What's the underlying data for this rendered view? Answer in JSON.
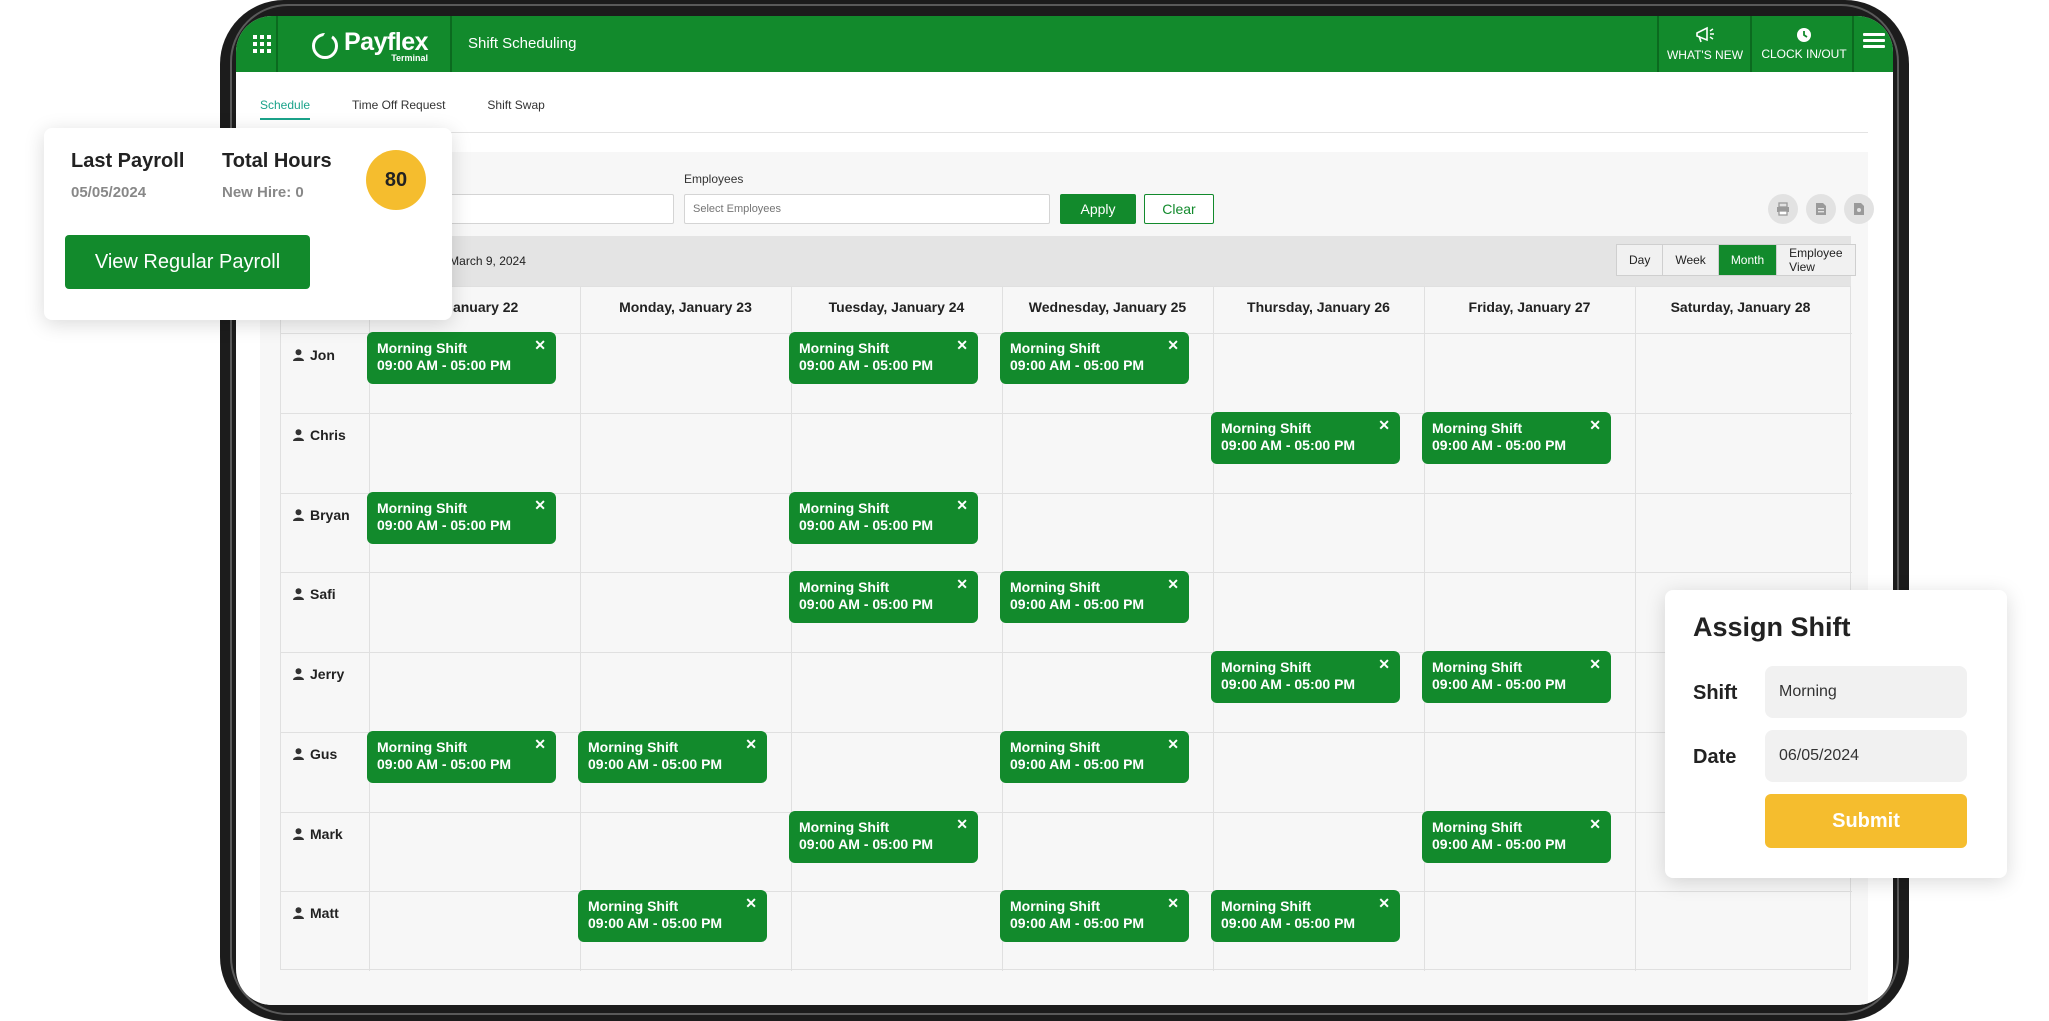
{
  "app": {
    "logo_text": "Payflex",
    "logo_sub": "Terminal",
    "title": "Shift Scheduling",
    "whats_new": "WHAT'S NEW",
    "clock": "CLOCK IN/OUT"
  },
  "tabs": [
    "Schedule",
    "Time Off Request",
    "Shift Swap"
  ],
  "filters": {
    "employees_label": "Employees",
    "employees_placeholder": "Select Employees",
    "apply": "Apply",
    "clear": "Clear"
  },
  "date_range": "3, 2024 – Saturday, March 9, 2024",
  "views": [
    "Day",
    "Week",
    "Month",
    "Employee View"
  ],
  "active_view": "Month",
  "days": [
    "y, January 22",
    "Monday, January 23",
    "Tuesday, January 24",
    "Wednesday, January 25",
    "Thursday, January 26",
    "Friday, January 27",
    "Saturday, January 28"
  ],
  "shift_name": "Morning Shift",
  "shift_time": "09:00 AM - 05:00 PM",
  "employees": [
    {
      "name": "Jon",
      "shifts": [
        0,
        2,
        3
      ]
    },
    {
      "name": "Chris",
      "shifts": [
        4,
        5
      ]
    },
    {
      "name": "Bryan",
      "shifts": [
        0,
        2
      ]
    },
    {
      "name": "Safi",
      "shifts": [
        2,
        3
      ]
    },
    {
      "name": "Jerry",
      "shifts": [
        4,
        5
      ]
    },
    {
      "name": "Gus",
      "shifts": [
        0,
        1,
        3
      ]
    },
    {
      "name": "Mark",
      "shifts": [
        2,
        5
      ]
    },
    {
      "name": "Matt",
      "shifts": [
        1,
        3,
        4
      ]
    }
  ],
  "payroll_card": {
    "last_payroll_label": "Last Payroll",
    "last_payroll_date": "05/05/2024",
    "total_hours_label": "Total Hours",
    "new_hire": "New Hire: 0",
    "hours": "80",
    "button": "View Regular Payroll"
  },
  "assign_card": {
    "title": "Assign Shift",
    "shift_label": "Shift",
    "shift_value": "Morning",
    "date_label": "Date",
    "date_value": "06/05/2024",
    "submit": "Submit"
  },
  "colors": {
    "primary_green": "#128a2c",
    "accent_yellow": "#f5bd2e",
    "tab_active": "#1aa38a"
  }
}
